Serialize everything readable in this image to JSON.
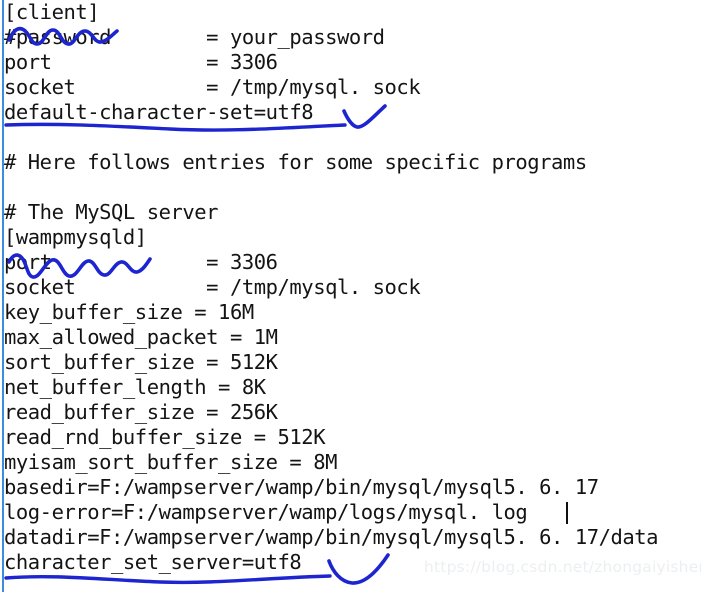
{
  "document": {
    "kind": "mysql-config-file",
    "lines": [
      "[client]",
      "#password        = your_password",
      "port             = 3306",
      "socket           = /tmp/mysql. sock",
      "default-character-set=utf8",
      "",
      "# Here follows entries for some specific programs",
      "",
      "# The MySQL server",
      "[wampmysqld]",
      "port             = 3306",
      "socket           = /tmp/mysql. sock",
      "key_buffer_size = 16M",
      "max_allowed_packet = 1M",
      "sort_buffer_size = 512K",
      "net_buffer_length = 8K",
      "read_buffer_size = 256K",
      "read_rnd_buffer_size = 512K",
      "myisam_sort_buffer_size = 8M",
      "basedir=F:/wampserver/wamp/bin/mysql/mysql5. 6. 17",
      "log-error=F:/wampserver/wamp/logs/mysql. log",
      "datadir=F:/wampserver/wamp/bin/mysql/mysql5. 6. 17/data",
      "character_set_server=utf8"
    ]
  },
  "annotations": {
    "ink_color": "#1c25cf",
    "marks": [
      {
        "name": "scribble-over-password",
        "type": "scribble",
        "target_line": 1
      },
      {
        "name": "underline-default-character-set",
        "type": "underline",
        "target_line": 4
      },
      {
        "name": "checkmark-default-character-set",
        "type": "checkmark",
        "target_line": 4
      },
      {
        "name": "scribble-over-port",
        "type": "scribble",
        "target_line": 10
      },
      {
        "name": "underline-character-set-server",
        "type": "underline",
        "target_line": 22
      },
      {
        "name": "checkmark-character-set-server",
        "type": "checkmark",
        "target_line": 22
      }
    ]
  },
  "watermark": {
    "text": "https://blog.csdn.net/zhongaiyisheng_",
    "color": "#eceff1"
  },
  "gutter": {
    "color": "#3d8ce0"
  }
}
